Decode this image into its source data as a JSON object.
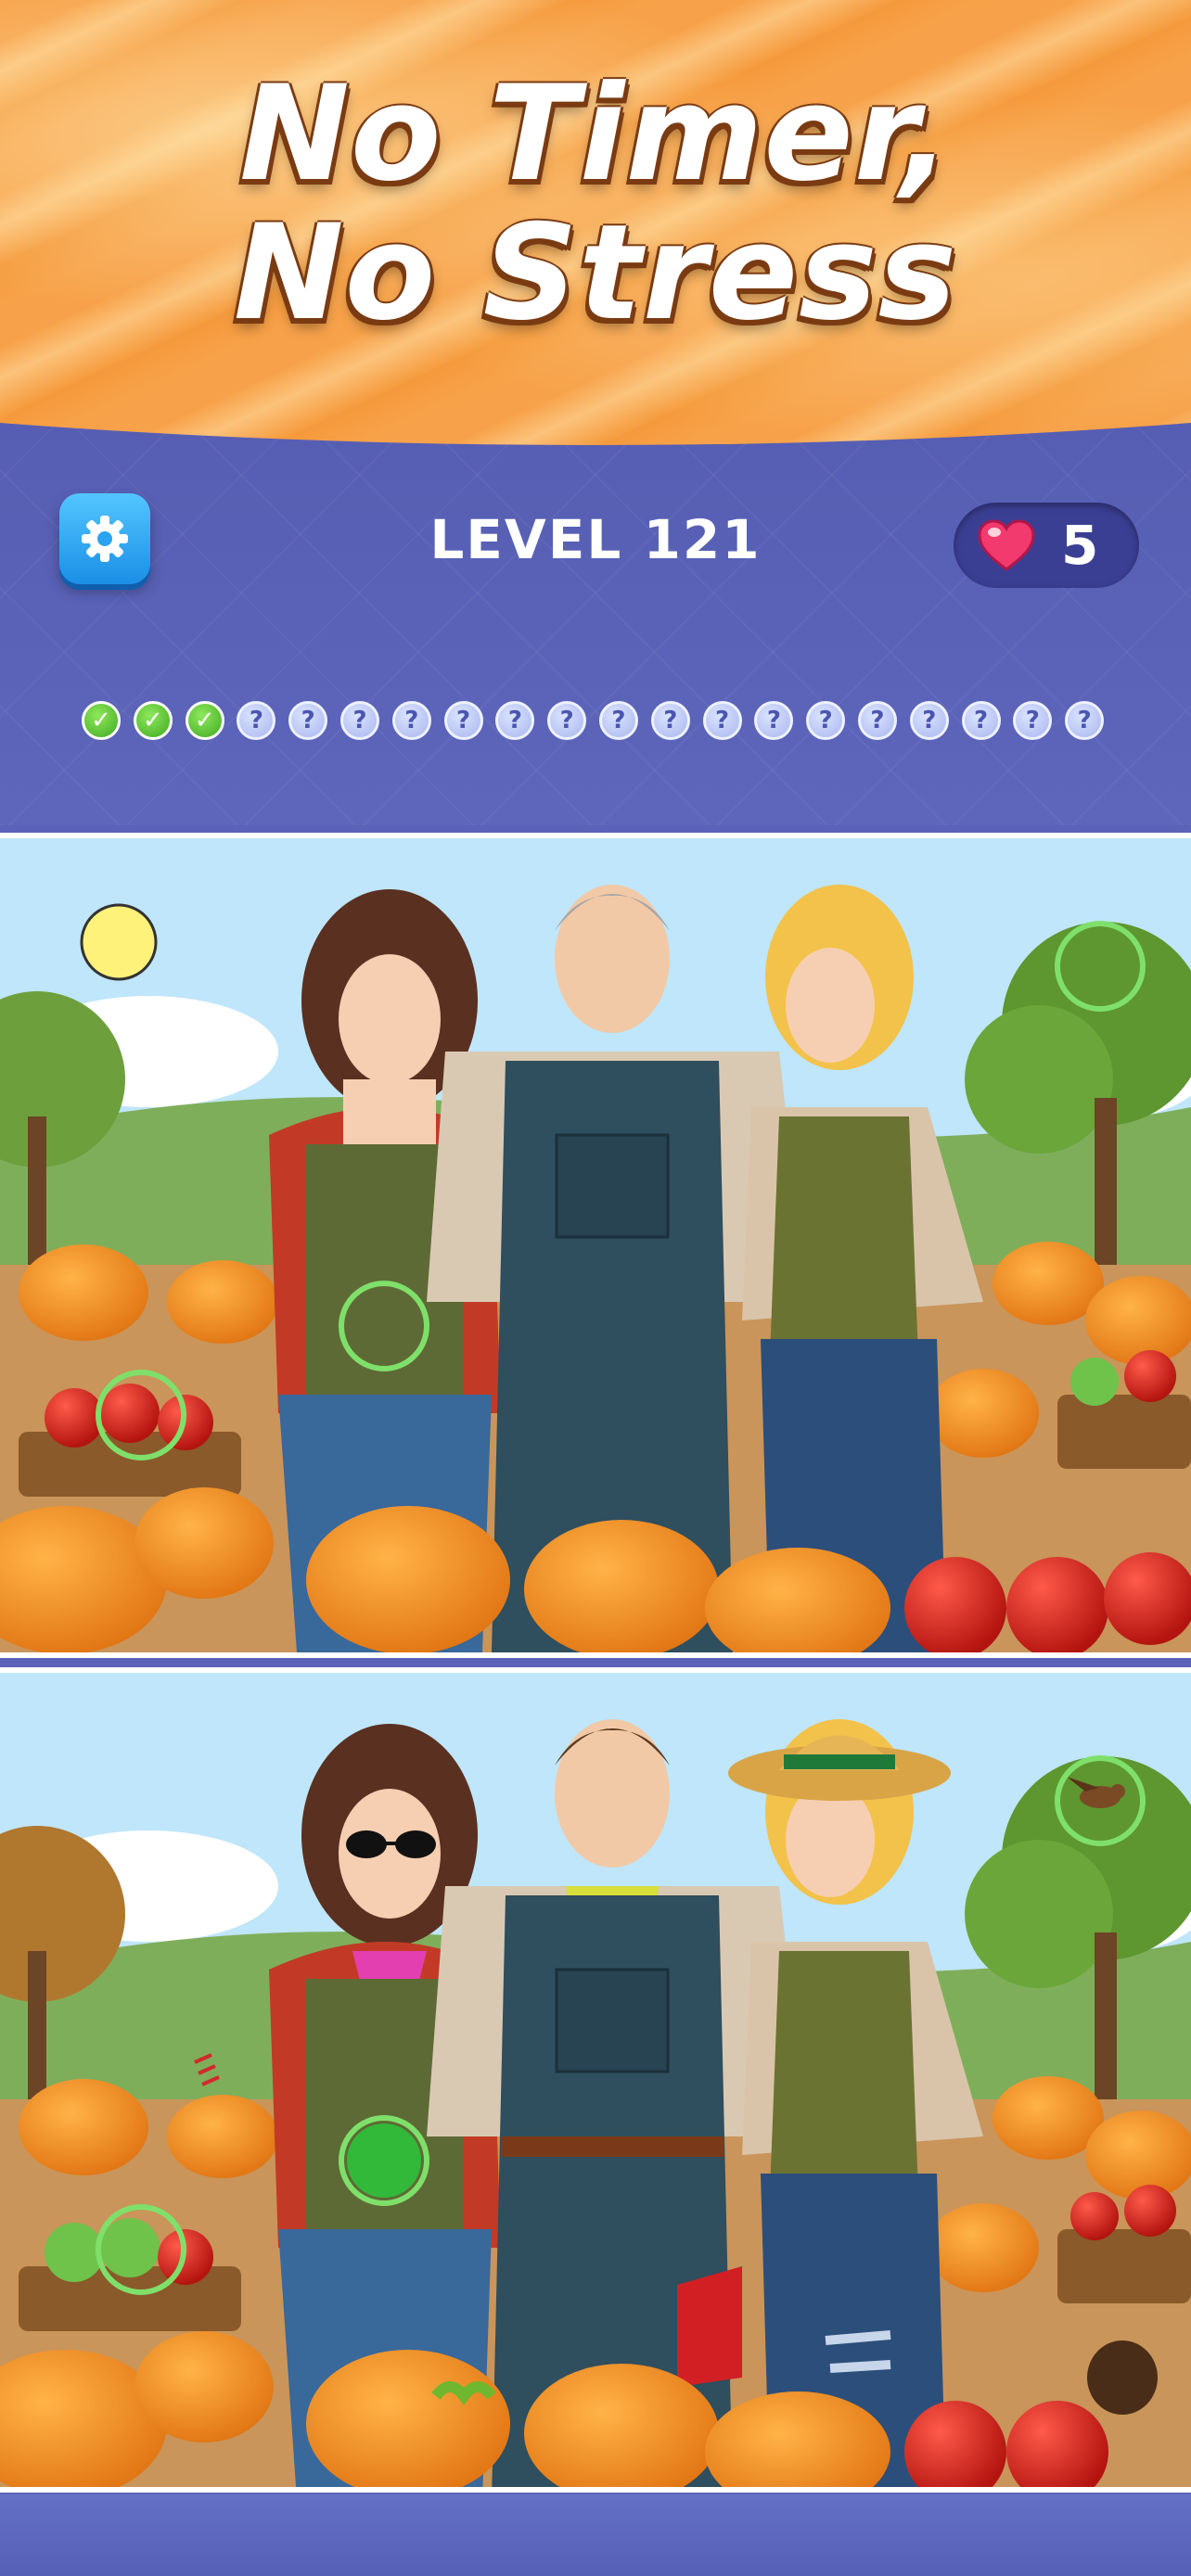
{
  "banner": {
    "line1": "No Timer,",
    "line2": "No Stress"
  },
  "header": {
    "settings_icon": "gear-icon",
    "level_label": "LEVEL 121",
    "lives_icon": "heart-icon",
    "lives_count": "5"
  },
  "progress": {
    "found": 3,
    "total": 20,
    "found_symbol": "✓",
    "unknown_symbol": "?"
  },
  "colors": {
    "banner_orange": "#f7a24a",
    "header_blue": "#5b63b8",
    "found_green": "#4cbb2a",
    "marker_ring": "#7ee06a",
    "settings_blue": "#1b8fe6",
    "heart_pink": "#f23a6f"
  },
  "scenes": {
    "top_image": "autumn-pumpkin-farm-three-farmers-original",
    "bottom_image": "autumn-pumpkin-farm-three-farmers-modified"
  }
}
